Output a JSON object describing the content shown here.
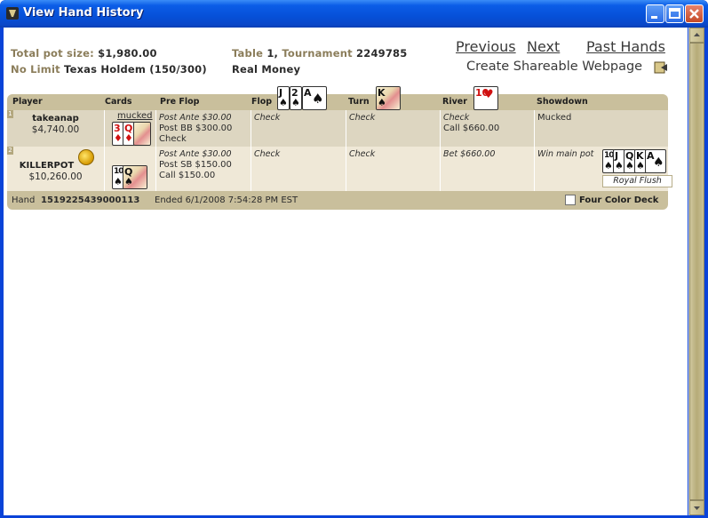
{
  "window": {
    "title": "View Hand History"
  },
  "summary": {
    "total_pot_label": "Total pot size:",
    "total_pot_value": "$1,980.00",
    "game_prefix": "No Limit",
    "game_name": "Texas Holdem",
    "stakes": "(150/300)",
    "table_label": "Table",
    "table_value": "1,",
    "tournament_label": "Tournament",
    "tournament_value": "2249785",
    "money_type": "Real Money"
  },
  "nav": {
    "previous": "Previous",
    "next": "Next",
    "past_hands": "Past Hands",
    "share": "Create Shareable Webpage"
  },
  "columns": {
    "player": "Player",
    "cards": "Cards",
    "preflop": "Pre Flop",
    "flop": "Flop",
    "turn": "Turn",
    "river": "River",
    "showdown": "Showdown"
  },
  "board": {
    "flop": [
      {
        "rank": "J",
        "suit": "♠",
        "color": "black"
      },
      {
        "rank": "2",
        "suit": "♠",
        "color": "black"
      },
      {
        "rank": "A",
        "suit": "♠",
        "color": "black"
      }
    ],
    "turn": [
      {
        "rank": "K",
        "suit": "♠",
        "color": "black"
      }
    ],
    "river": [
      {
        "rank": "10",
        "suit": "♥",
        "color": "red"
      }
    ]
  },
  "players": [
    {
      "seat": "1",
      "name": "takeanap",
      "chips": "$4,740.00",
      "cards_label": "mucked",
      "cards": [
        {
          "rank": "3",
          "suit": "♦",
          "color": "red"
        },
        {
          "rank": "Q",
          "suit": "♦",
          "color": "red"
        },
        {
          "rank": "",
          "suit": "",
          "color": "black"
        }
      ],
      "preflop": [
        "Post Ante $30.00",
        "Post BB $300.00",
        "Check"
      ],
      "flop": [
        "Check"
      ],
      "turn": [
        "Check"
      ],
      "river": [
        "Check",
        "Call $660.00"
      ],
      "showdown": [
        "Mucked"
      ]
    },
    {
      "seat": "2",
      "name": "KILLERPOT",
      "chips": "$10,260.00",
      "cards": [
        {
          "rank": "10",
          "suit": "♠",
          "color": "black"
        },
        {
          "rank": "Q",
          "suit": "♠",
          "color": "black"
        }
      ],
      "preflop": [
        "Post Ante $30.00",
        "Post SB $150.00",
        "Call $150.00"
      ],
      "flop": [
        "Check"
      ],
      "turn": [
        "Check"
      ],
      "river": [
        "Bet $660.00"
      ],
      "showdown": [
        "Win main pot"
      ],
      "best_hand": [
        {
          "rank": "10",
          "suit": "♠",
          "color": "black"
        },
        {
          "rank": "J",
          "suit": "♠",
          "color": "black"
        },
        {
          "rank": "Q",
          "suit": "♠",
          "color": "black"
        },
        {
          "rank": "K",
          "suit": "♠",
          "color": "black"
        },
        {
          "rank": "A",
          "suit": "♠",
          "color": "black"
        }
      ],
      "best_hand_name": "Royal Flush"
    }
  ],
  "footer": {
    "hand_label": "Hand",
    "hand_id": "1519225439000113",
    "ended": "Ended 6/1/2008 7:54:28 PM EST",
    "four_color_label": "Four Color Deck"
  }
}
